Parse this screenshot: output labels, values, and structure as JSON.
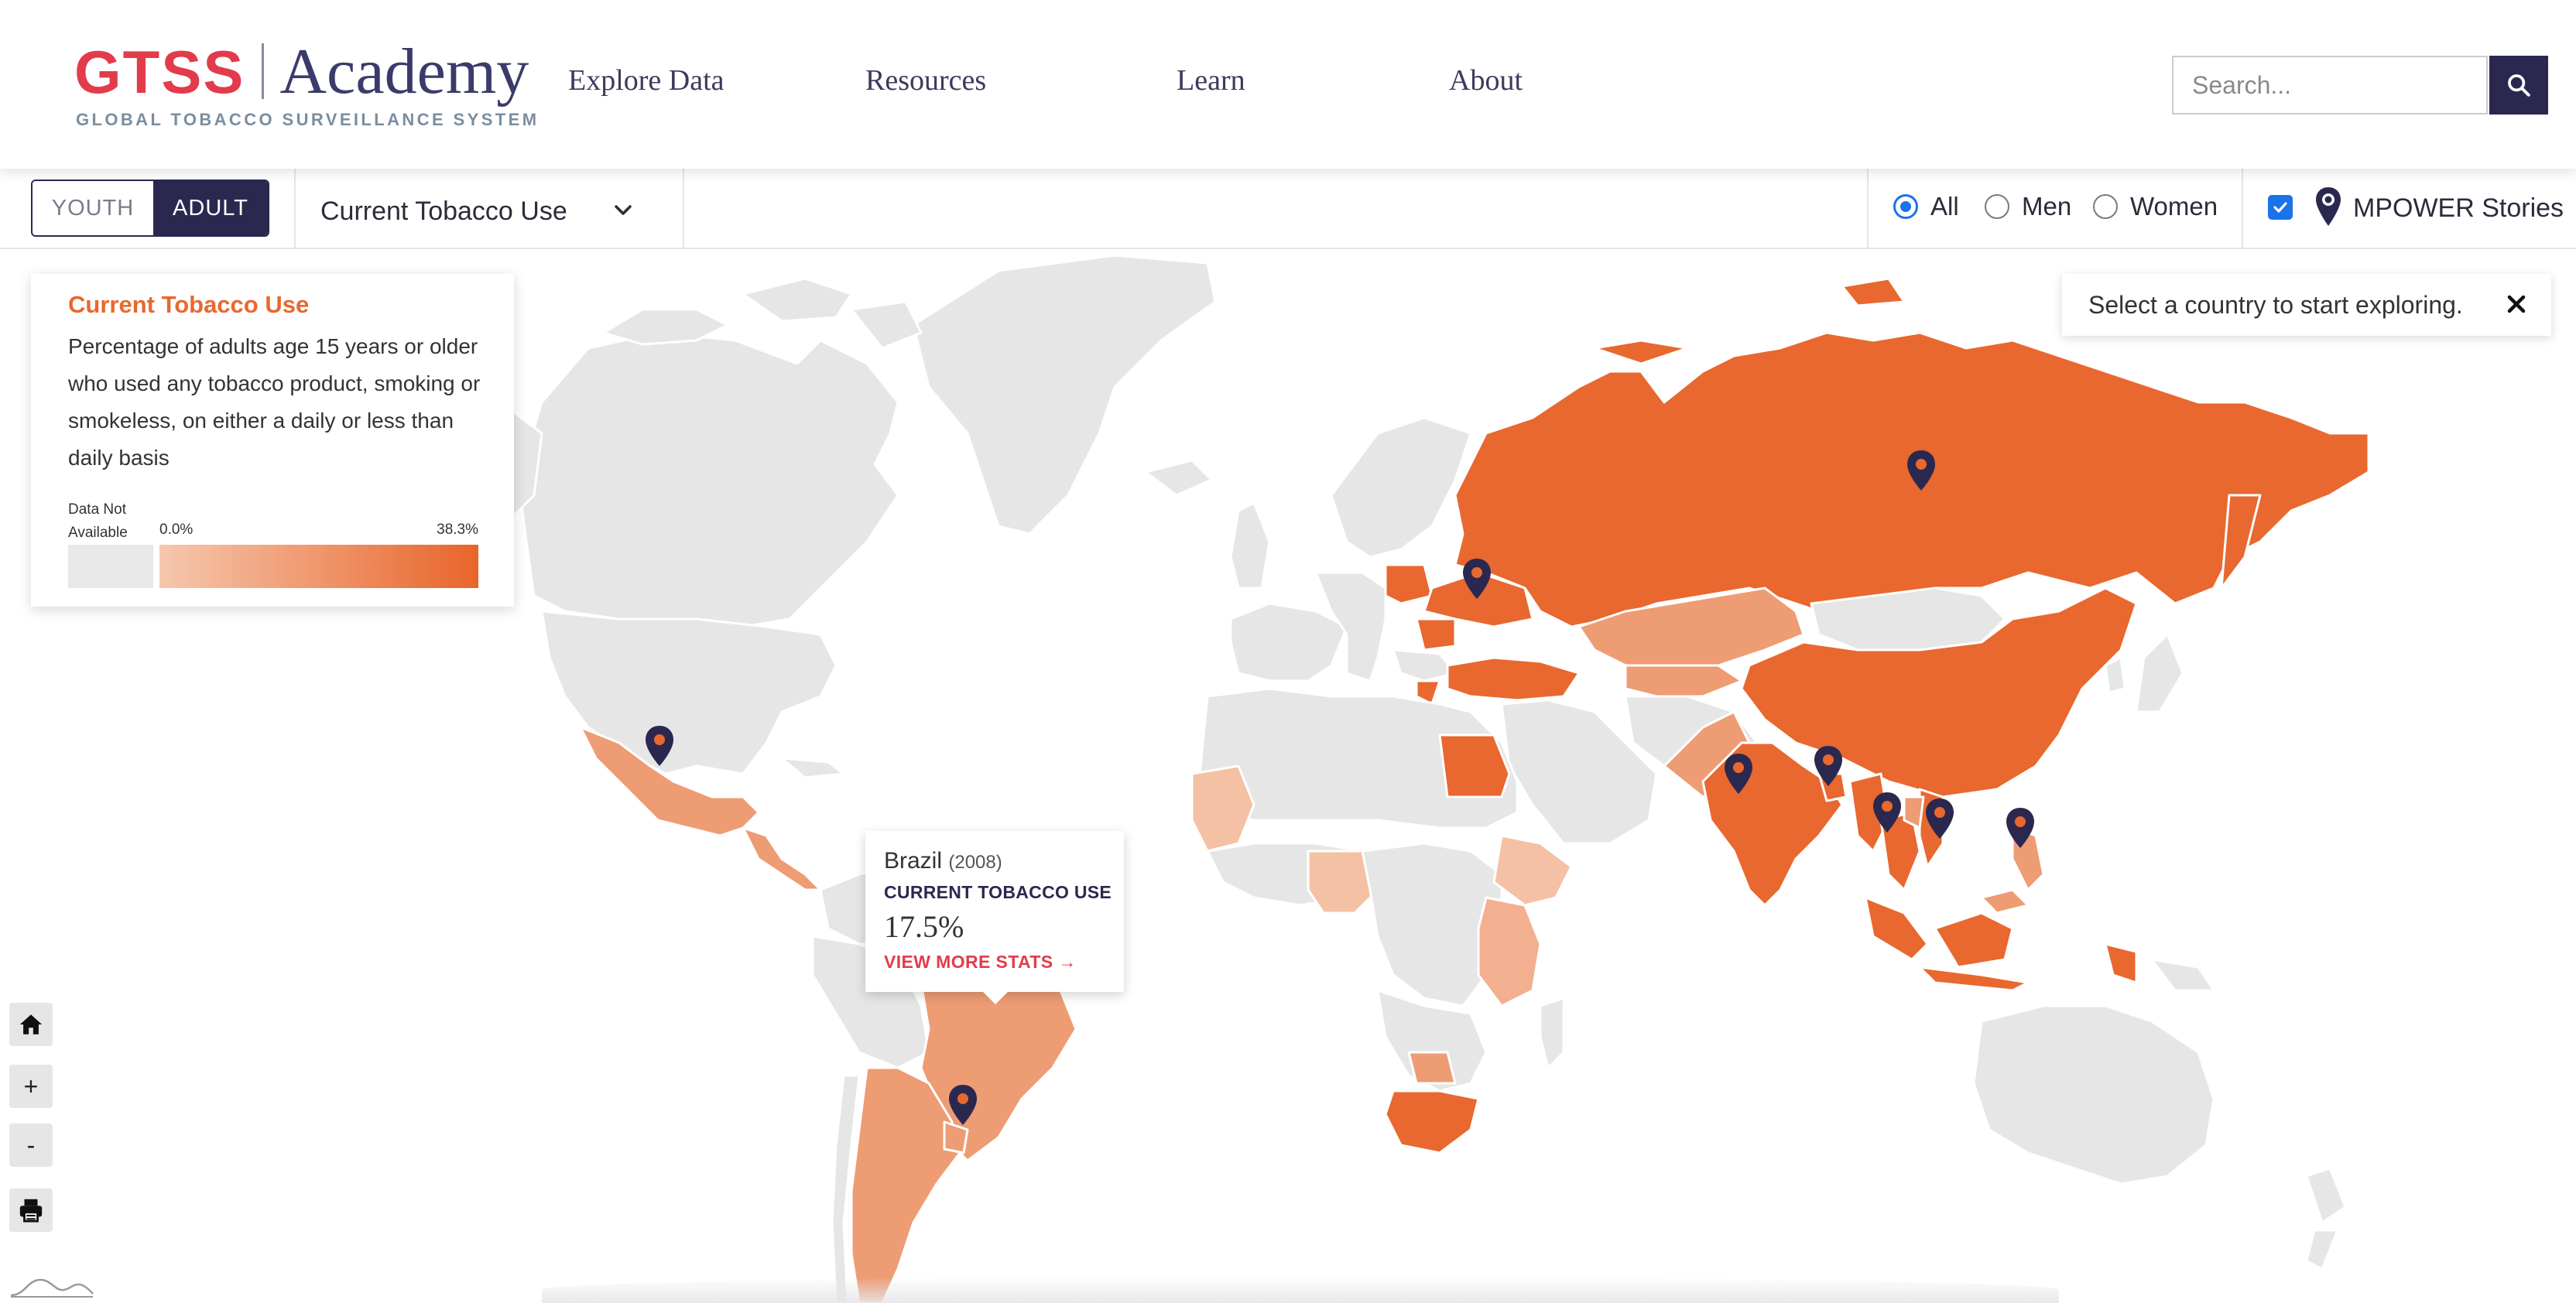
{
  "header": {
    "logo_primary": "GTSS",
    "logo_secondary": "Academy",
    "logo_tagline": "GLOBAL TOBACCO SURVEILLANCE SYSTEM",
    "nav": [
      "Explore Data",
      "Resources",
      "Learn",
      "About"
    ],
    "search_placeholder": "Search..."
  },
  "toolbar": {
    "toggle": {
      "youth": "YOUTH",
      "adult": "ADULT",
      "selected": "ADULT"
    },
    "indicator": "Current Tobacco Use",
    "gender_options": [
      "All",
      "Men",
      "Women"
    ],
    "gender_selected": "All",
    "mpower_label": "MPOWER Stories",
    "mpower_checked": true
  },
  "legend": {
    "title": "Current Tobacco Use",
    "description": "Percentage of adults age 15 years or older who used any tobacco product, smoking or smokeless, on either a daily or less than daily basis",
    "na_label": "Data Not Available",
    "min_label": "0.0%",
    "max_label": "38.3%",
    "color_low": "#f6c7ae",
    "color_high": "#e8652a",
    "color_na": "#e8e8e8"
  },
  "notice": {
    "text": "Select a country to start exploring."
  },
  "tooltip": {
    "country": "Brazil",
    "year": "(2008)",
    "metric": "CURRENT TOBACCO USE",
    "value": "17.5%",
    "link": "VIEW MORE STATS →"
  },
  "controls": {
    "icons": [
      "home-icon",
      "zoom-in",
      "zoom-out",
      "print-icon"
    ],
    "zoom_in": "+",
    "zoom_out": "-"
  },
  "colors": {
    "brand_red": "#e23c4c",
    "brand_navy": "#2b2850",
    "accent_orange": "#e8682f",
    "land_no_data": "#e8e8e8"
  }
}
